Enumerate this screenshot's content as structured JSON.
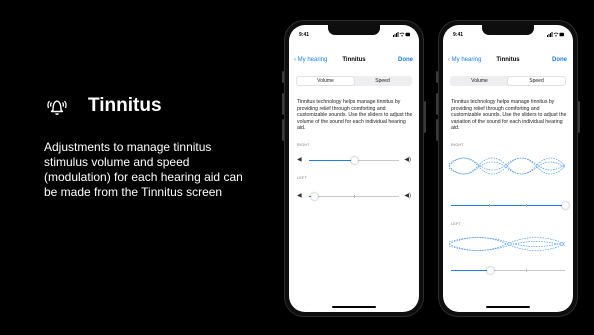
{
  "slide": {
    "title": "Tinnitus",
    "description": "Adjustments to manage tinnitus stimulus volume and speed (modulation) for each hearing aid can be made from the Tinnitus screen",
    "title_icon": "bell-sound-icon"
  },
  "phone_left": {
    "status": {
      "time": "9:41",
      "icons": "signal-wifi-battery"
    },
    "nav": {
      "back_label": "My hearing",
      "title": "Tinnitus",
      "done_label": "Done"
    },
    "segments": [
      {
        "label": "Volume",
        "selected": true
      },
      {
        "label": "Speed",
        "selected": false
      }
    ],
    "body_text": "Tinnitus technology helps manage tinnitus by providing relief through comforting and customizable sounds. Use the sliders to adjust the volume of the sound for each individual hearing aid.",
    "right_label": "RIGHT",
    "left_label": "LEFT",
    "right_volume": 0.5,
    "left_volume": 0.06
  },
  "phone_right": {
    "status": {
      "time": "9:41",
      "icons": "signal-wifi-battery"
    },
    "nav": {
      "back_label": "My hearing",
      "title": "Tinnitus",
      "done_label": "Done"
    },
    "segments": [
      {
        "label": "Volume",
        "selected": false
      },
      {
        "label": "Speed",
        "selected": true
      }
    ],
    "body_text": "Tinnitus technology helps manage tinnitus by providing relief through comforting and customizable sounds. Use the sliders to adjust the variation of the sound for each individual hearing aid.",
    "right_label": "RIGHT",
    "left_label": "LEFT",
    "right_speed": 1.0,
    "left_speed": 0.35
  },
  "colors": {
    "accent": "#1a7df2",
    "background": "#000000",
    "wave": "#3b8fe6"
  }
}
